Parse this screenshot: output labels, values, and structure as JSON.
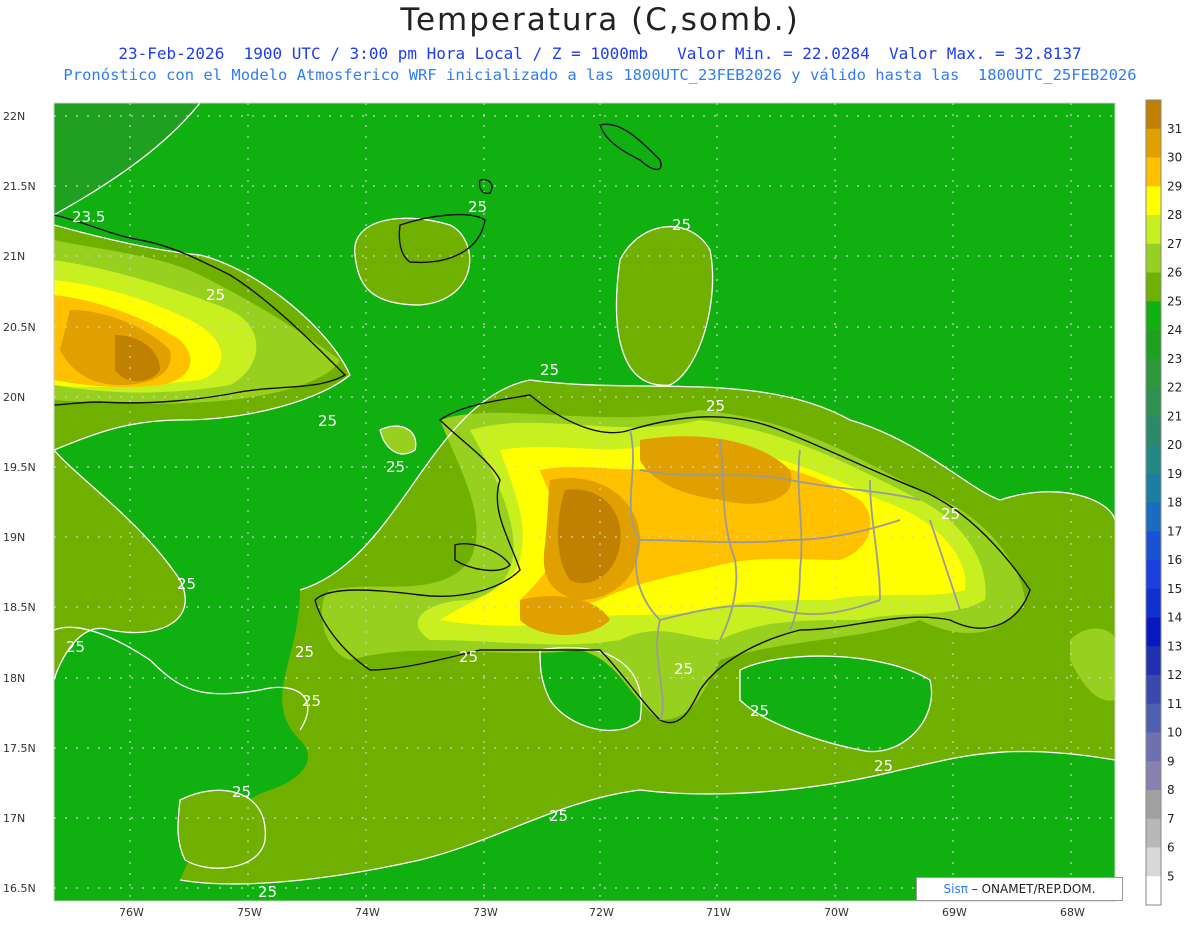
{
  "header": {
    "title": "Temperatura (C,somb.)",
    "line1": "23-Feb-2026  1900 UTC / 3:00 pm Hora Local / Z = 1000mb   Valor Min. = 22.0284  Valor Max. = 32.8137",
    "line2": "Pronóstico con el Modelo Atmosferico WRF inicializado a las 1800UTC_23FEB2026 y válido hasta las  1800UTC_25FEB2026"
  },
  "map": {
    "lat_labels": [
      "22N",
      "21.5N",
      "21N",
      "20.5N",
      "20N",
      "19.5N",
      "19N",
      "18.5N",
      "18N",
      "17.5N",
      "17N",
      "16.5N"
    ],
    "lon_labels": [
      "76W",
      "75W",
      "74W",
      "73W",
      "72W",
      "71W",
      "70W",
      "69W",
      "68W"
    ],
    "contour_labels": [
      "23.5",
      "25",
      "25",
      "25",
      "25",
      "25",
      "25",
      "25",
      "25",
      "25",
      "25",
      "25",
      "25",
      "25",
      "25",
      "25",
      "25",
      "25",
      "25",
      "25"
    ],
    "grid": true
  },
  "colorbar": {
    "ticks": [
      "31",
      "30",
      "29",
      "28",
      "27",
      "26",
      "25",
      "24",
      "23",
      "22",
      "21",
      "20",
      "19",
      "18",
      "17",
      "16",
      "15",
      "14",
      "13",
      "12",
      "11",
      "10",
      "9",
      "8",
      "7",
      "6",
      "5"
    ],
    "colors": [
      "#c08000",
      "#e0a000",
      "#ffc000",
      "#ffff00",
      "#c8f020",
      "#98d020",
      "#70b000",
      "#10b010",
      "#20a020",
      "#2c9a3c",
      "#309050",
      "#2c8a6a",
      "#248884",
      "#1a7fa0",
      "#1a6cc0",
      "#1a52d6",
      "#1a40e0",
      "#1030d0",
      "#0818c0",
      "#2030b0",
      "#3a48b0",
      "#5060b0",
      "#7070b0",
      "#8a80b0",
      "#a0a0a0",
      "#b8b8b8",
      "#d8d8d8",
      "#ffffff"
    ]
  },
  "credit": {
    "brand": "Sisπ",
    "text": " – ONAMET/REP.DOM."
  }
}
